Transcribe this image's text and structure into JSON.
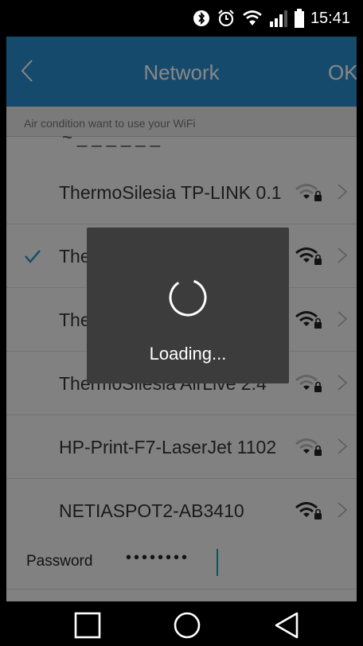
{
  "status": {
    "time": "15:41",
    "icons": [
      "bluetooth-icon",
      "alarm-icon",
      "wifi-icon",
      "signal-icon",
      "battery-icon"
    ]
  },
  "header": {
    "title": "Network",
    "back_icon": "chevron-left-icon",
    "ok_label": "OK",
    "background_color": "#2b8ccf"
  },
  "subheader": {
    "text": "Air condition want to use your WiFi"
  },
  "networks": [
    {
      "ssid": "ThermoSilesia TP-LINK 0.1",
      "selected": false,
      "signal": "weak",
      "locked": true
    },
    {
      "ssid": "ThermoSilesia TP-LINK 2.1",
      "selected": true,
      "signal": "strong",
      "locked": true
    },
    {
      "ssid": "ThermoSilesia NETIASPOT",
      "selected": false,
      "signal": "strong",
      "locked": true
    },
    {
      "ssid": "ThermoSilesia AirLive 2.4",
      "selected": false,
      "signal": "weak",
      "locked": true
    },
    {
      "ssid": "HP-Print-F7-LaserJet 1102",
      "selected": false,
      "signal": "weak",
      "locked": true
    },
    {
      "ssid": "NETIASPOT2-AB3410",
      "selected": false,
      "signal": "strong",
      "locked": true
    }
  ],
  "password": {
    "label": "Password",
    "value": "••••••••"
  },
  "loading": {
    "text": "Loading...",
    "icon": "spinner-icon"
  },
  "navbar": {
    "icons": [
      "recent-apps-icon",
      "home-icon",
      "back-icon"
    ]
  }
}
